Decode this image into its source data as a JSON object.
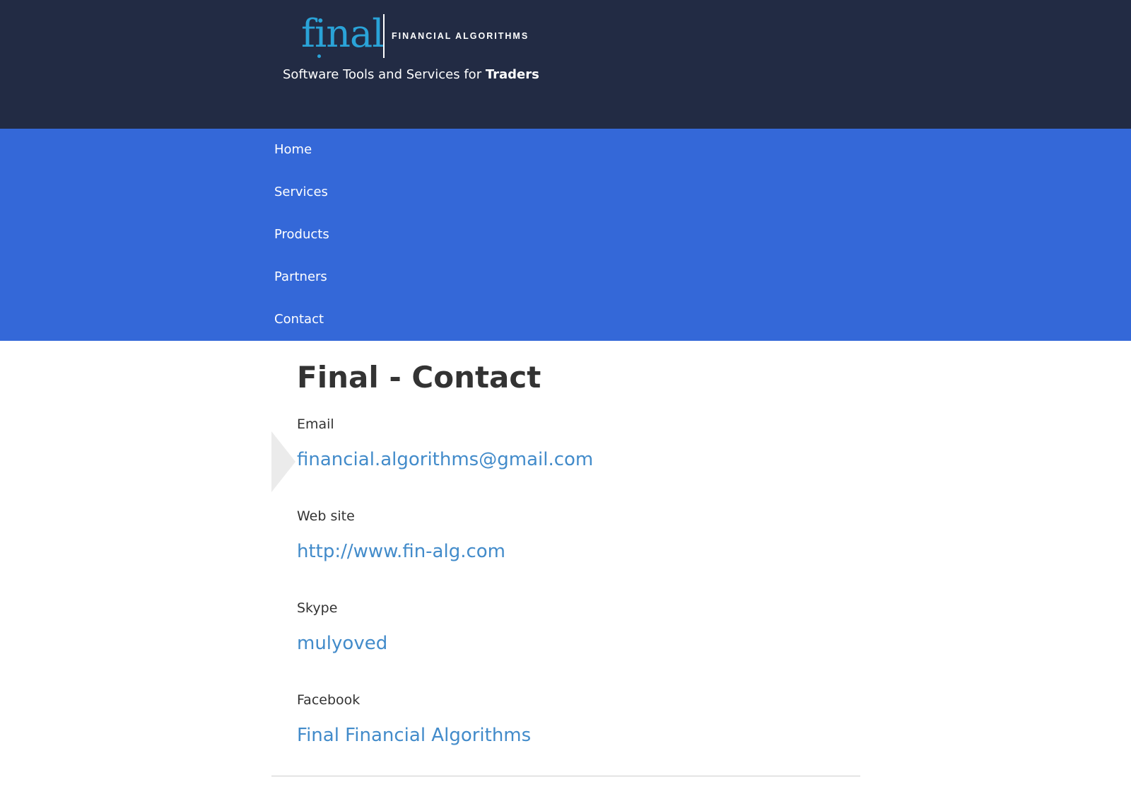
{
  "brand": {
    "logo_word": "final",
    "logo_subtitle": "FINANCIAL ALGORITHMS",
    "tagline_prefix": "Software Tools and Services for ",
    "tagline_bold": "Traders",
    "logo_color": "#2aa3d8"
  },
  "colors": {
    "header_bg": "#222b44",
    "nav_bg": "#3468d8",
    "link": "#428bca"
  },
  "nav": {
    "items": [
      {
        "label": "Home"
      },
      {
        "label": "Services"
      },
      {
        "label": "Products"
      },
      {
        "label": "Partners"
      },
      {
        "label": "Contact"
      }
    ]
  },
  "main": {
    "title": "Final - Contact",
    "fields": [
      {
        "label": "Email",
        "value": "financial.algorithms@gmail.com"
      },
      {
        "label": "Web site",
        "value": "http://www.fin-alg.com"
      },
      {
        "label": "Skype",
        "value": "mulyoved"
      },
      {
        "label": "Facebook",
        "value": "Final Financial Algorithms"
      }
    ]
  }
}
